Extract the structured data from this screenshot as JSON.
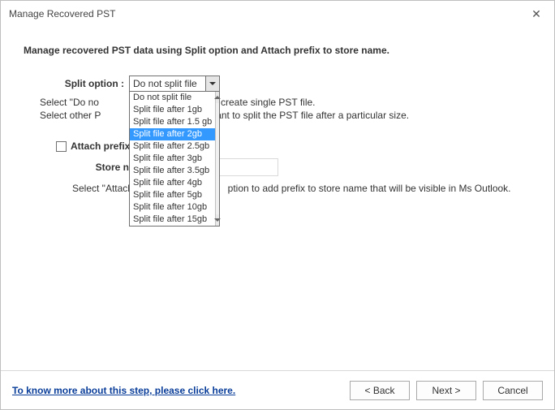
{
  "window": {
    "title": "Manage Recovered PST"
  },
  "heading": "Manage recovered PST data using Split option and Attach prefix to store name.",
  "split": {
    "label": "Split option :",
    "selected": "Do not split file",
    "options": [
      "Do not split file",
      "Split file after 1gb",
      "Split file after 1.5 gb",
      "Split file after 2gb",
      "Split file after 2.5gb",
      "Split file after 3gb",
      "Split file after 3.5gb",
      "Split file after 4gb",
      "Split file after 5gb",
      "Split file after 10gb",
      "Split file after 15gb"
    ],
    "highlight_index": 3,
    "hint1_prefix": "Select \"Do no",
    "hint1_suffix": "ant to create single PST file.",
    "hint2_prefix": "Select other P",
    "hint2_suffix": "ou want to split the PST file after a particular size."
  },
  "attach": {
    "checkbox_label": "Attach prefix t",
    "store_label": "Store name",
    "hint_prefix": "Select \"Attach",
    "hint_suffix": "ption to add prefix to store name that will be visible in Ms Outlook."
  },
  "footer": {
    "link": "To know more about this step, please click here.",
    "back": "< Back",
    "next": "Next >",
    "cancel": "Cancel"
  }
}
